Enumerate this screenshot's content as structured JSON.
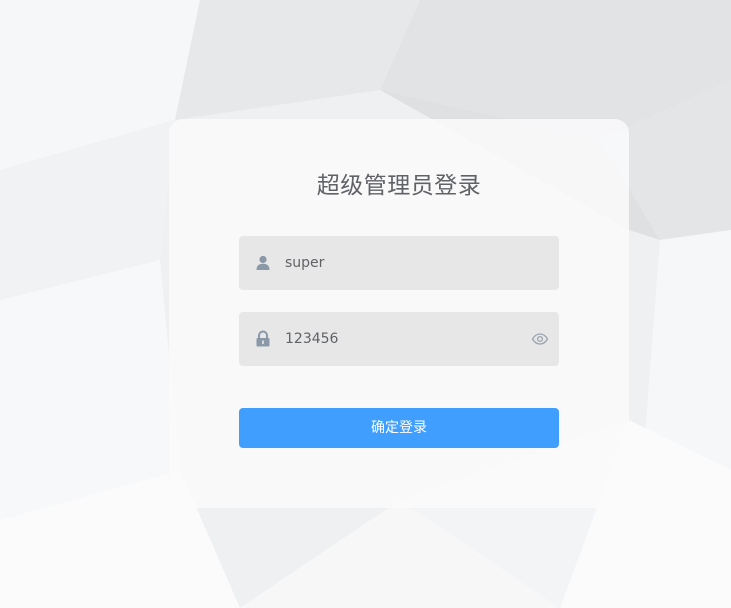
{
  "login": {
    "title": "超级管理员登录",
    "username_value": "super",
    "password_value": "123456",
    "submit_label": "确定登录"
  },
  "icons": {
    "user": "user-icon",
    "lock": "lock-icon",
    "show_password": "eye-icon"
  },
  "colors": {
    "primary": "#409eff",
    "input_bg": "#e7e7e7",
    "text": "#606266",
    "icon": "#8a98a8"
  }
}
